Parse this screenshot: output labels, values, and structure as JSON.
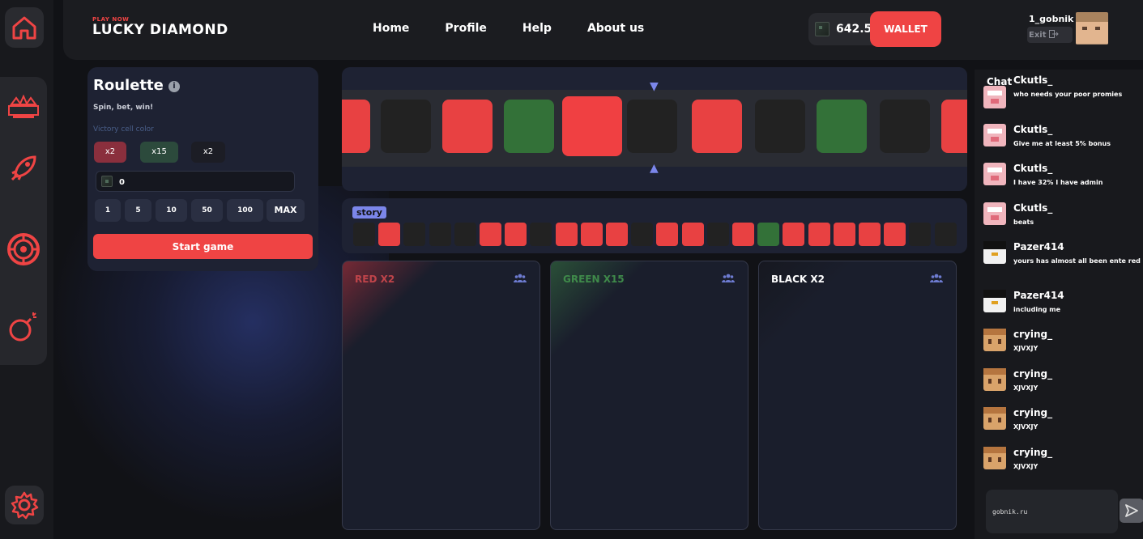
{
  "header": {
    "brand_small": "PLAY NOW",
    "brand_name": "LUCKY DIAMOND",
    "nav": [
      "Home",
      "Profile",
      "Help",
      "About us"
    ],
    "balance": "642.5",
    "wallet_label": "WALLET",
    "username": "1_gobnik",
    "exit_label": "Exit"
  },
  "roulette": {
    "title": "Roulette",
    "subtitle": "Spin, bet, win!",
    "victory_label": "Victory cell color",
    "color_options": [
      "x2",
      "x15",
      "x2"
    ],
    "bet_value": "0",
    "quick_bets": [
      "1",
      "5",
      "10",
      "50",
      "100",
      "MAX"
    ],
    "start_label": "Start game"
  },
  "strip": {
    "tiles": [
      "red",
      "black",
      "red",
      "green",
      "red",
      "black",
      "red",
      "black",
      "green",
      "black",
      "red"
    ],
    "selected_index": 4
  },
  "story": {
    "label": "story",
    "cells": [
      "black",
      "red",
      "black",
      "black",
      "black",
      "red",
      "red",
      "black",
      "red",
      "red",
      "red",
      "black",
      "red",
      "red",
      "black",
      "red",
      "green",
      "red",
      "red",
      "red",
      "red",
      "red",
      "black",
      "black"
    ]
  },
  "panels": [
    {
      "title": "RED X2",
      "color": "#c0444a"
    },
    {
      "title": "GREEN X15",
      "color": "#3f8a4a"
    },
    {
      "title": "BLACK X2",
      "color": "#ffffff"
    }
  ],
  "colors": {
    "red": "#e84142",
    "green": "#337138",
    "black": "#222222",
    "accent": "#ef4444",
    "story_accent": "#7b86ea"
  },
  "chat": {
    "title": "Chat",
    "messages": [
      {
        "name": "Ckutls_",
        "text": "who needs your poor promies",
        "avatar": "pig"
      },
      {
        "name": "Ckutls_",
        "text": "Give me at least 5% bonus",
        "avatar": "pig"
      },
      {
        "name": "Ckutls_",
        "text": "I have 32% I have admin",
        "avatar": "pig"
      },
      {
        "name": "Ckutls_",
        "text": "beats",
        "avatar": "pig"
      },
      {
        "name": "Pazer414",
        "text": "yours has almost all been ente red",
        "avatar": "penguin"
      },
      {
        "name": "Pazer414",
        "text": "including me",
        "avatar": "penguin"
      },
      {
        "name": "crying_",
        "text": "XJVXJY",
        "avatar": "crying"
      },
      {
        "name": "crying_",
        "text": "XJVXJY",
        "avatar": "crying"
      },
      {
        "name": "crying_",
        "text": "XJVXJY",
        "avatar": "crying"
      },
      {
        "name": "crying_",
        "text": "XJVXJY",
        "avatar": "crying"
      }
    ],
    "input_value": "gobnik.ru"
  }
}
